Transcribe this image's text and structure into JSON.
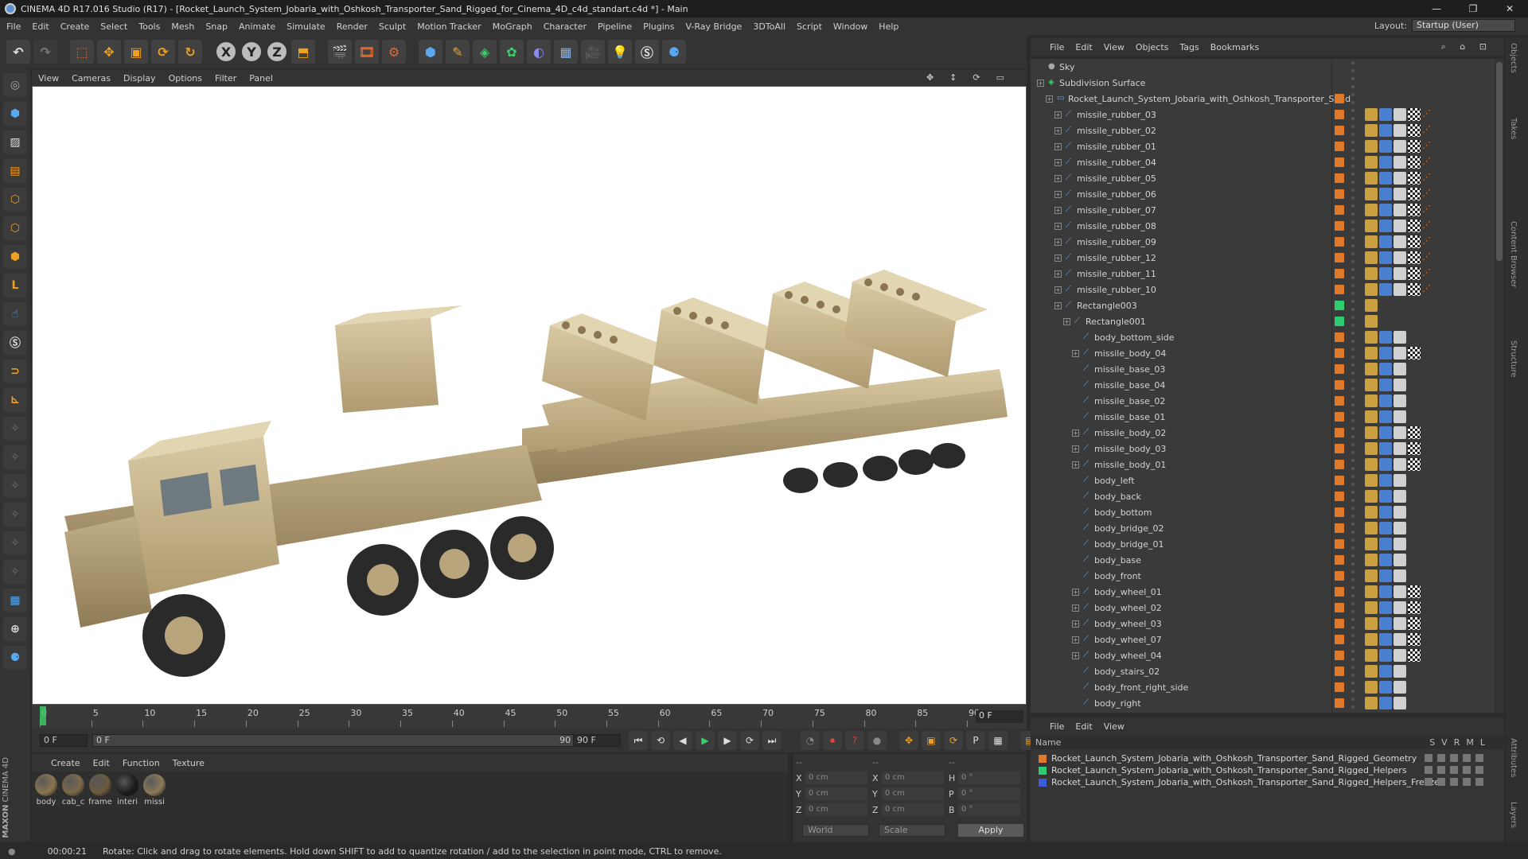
{
  "window": {
    "title": "CINEMA 4D R17.016 Studio (R17) - [Rocket_Launch_System_Jobaria_with_Oshkosh_Transporter_Sand_Rigged_for_Cinema_4D_c4d_standart.c4d *] - Main",
    "controls": [
      "—",
      "❐",
      "✕"
    ]
  },
  "menu": [
    "File",
    "Edit",
    "Create",
    "Select",
    "Tools",
    "Mesh",
    "Snap",
    "Animate",
    "Simulate",
    "Render",
    "Sculpt",
    "Motion Tracker",
    "MoGraph",
    "Character",
    "Pipeline",
    "Plugins",
    "V-Ray Bridge",
    "3DToAll",
    "Script",
    "Window",
    "Help"
  ],
  "layout": {
    "label": "Layout:",
    "value": "Startup (User)"
  },
  "toolbar": {
    "axis_x": "X",
    "axis_y": "Y",
    "axis_z": "Z"
  },
  "viewport_menu": [
    "View",
    "Cameras",
    "Display",
    "Options",
    "Filter",
    "Panel"
  ],
  "timeline": {
    "ticks": [
      "0",
      "5",
      "10",
      "15",
      "20",
      "25",
      "30",
      "35",
      "40",
      "45",
      "50",
      "55",
      "60",
      "65",
      "70",
      "75",
      "80",
      "85",
      "90"
    ],
    "current_frame": "0 F"
  },
  "playback": {
    "start": "0 F",
    "min": "0 F",
    "max_slider": "90 F",
    "end": "90 F"
  },
  "materials_menu": [
    "Create",
    "Edit",
    "Function",
    "Texture"
  ],
  "materials": [
    {
      "label": "body",
      "color": "#8a7650"
    },
    {
      "label": "cab_c",
      "color": "#7d6a48"
    },
    {
      "label": "frame",
      "color": "#6b5a3e"
    },
    {
      "label": "interi",
      "color": "#1c1c1c"
    },
    {
      "label": "missi",
      "color": "#8c7a58"
    }
  ],
  "coords": {
    "header": [
      "--",
      "--",
      "--"
    ],
    "rows": [
      {
        "a": "X",
        "av": "0 cm",
        "b": "X",
        "bv": "0 cm",
        "c": "H",
        "cv": "0 °"
      },
      {
        "a": "Y",
        "av": "0 cm",
        "b": "Y",
        "bv": "0 cm",
        "c": "P",
        "cv": "0 °"
      },
      {
        "a": "Z",
        "av": "0 cm",
        "b": "Z",
        "bv": "0 cm",
        "c": "B",
        "cv": "0 °"
      }
    ],
    "world": "World",
    "scale": "Scale",
    "apply": "Apply"
  },
  "objects_menu": [
    "File",
    "Edit",
    "View",
    "Objects",
    "Tags",
    "Bookmarks"
  ],
  "objects": [
    {
      "name": "Sky",
      "depth": 0,
      "expand": false,
      "icon": "sky",
      "layer": "",
      "tags": 0
    },
    {
      "name": "Subdivision Surface",
      "depth": 0,
      "expand": true,
      "icon": "subdiv",
      "layer": "",
      "tags": 0
    },
    {
      "name": "Rocket_Launch_System_Jobaria_with_Oshkosh_Transporter_Sand",
      "depth": 1,
      "expand": true,
      "icon": "null",
      "layer": "#e07a2a",
      "tags": 0
    },
    {
      "name": "missile_rubber_03",
      "depth": 2,
      "expand": true,
      "icon": "bone",
      "layer": "#e07a2a",
      "tags": 5
    },
    {
      "name": "missile_rubber_02",
      "depth": 2,
      "expand": true,
      "icon": "bone",
      "layer": "#e07a2a",
      "tags": 5
    },
    {
      "name": "missile_rubber_01",
      "depth": 2,
      "expand": true,
      "icon": "bone",
      "layer": "#e07a2a",
      "tags": 5
    },
    {
      "name": "missile_rubber_04",
      "depth": 2,
      "expand": true,
      "icon": "bone",
      "layer": "#e07a2a",
      "tags": 5
    },
    {
      "name": "missile_rubber_05",
      "depth": 2,
      "expand": true,
      "icon": "bone",
      "layer": "#e07a2a",
      "tags": 5
    },
    {
      "name": "missile_rubber_06",
      "depth": 2,
      "expand": true,
      "icon": "bone",
      "layer": "#e07a2a",
      "tags": 5
    },
    {
      "name": "missile_rubber_07",
      "depth": 2,
      "expand": true,
      "icon": "bone",
      "layer": "#e07a2a",
      "tags": 5
    },
    {
      "name": "missile_rubber_08",
      "depth": 2,
      "expand": true,
      "icon": "bone",
      "layer": "#e07a2a",
      "tags": 5
    },
    {
      "name": "missile_rubber_09",
      "depth": 2,
      "expand": true,
      "icon": "bone",
      "layer": "#e07a2a",
      "tags": 5
    },
    {
      "name": "missile_rubber_12",
      "depth": 2,
      "expand": true,
      "icon": "bone",
      "layer": "#e07a2a",
      "tags": 5
    },
    {
      "name": "missile_rubber_11",
      "depth": 2,
      "expand": true,
      "icon": "bone",
      "layer": "#e07a2a",
      "tags": 5
    },
    {
      "name": "missile_rubber_10",
      "depth": 2,
      "expand": true,
      "icon": "bone",
      "layer": "#e07a2a",
      "tags": 5
    },
    {
      "name": "Rectangle003",
      "depth": 2,
      "expand": true,
      "icon": "bone",
      "layer": "#2ecc71",
      "tags": 1
    },
    {
      "name": "Rectangle001",
      "depth": 3,
      "expand": true,
      "icon": "bone",
      "layer": "#2ecc71",
      "tags": 1
    },
    {
      "name": "body_bottom_side",
      "depth": 4,
      "expand": false,
      "icon": "bone",
      "layer": "#e07a2a",
      "tags": 3
    },
    {
      "name": "missile_body_04",
      "depth": 4,
      "expand": true,
      "icon": "bone",
      "layer": "#e07a2a",
      "tags": 4
    },
    {
      "name": "missile_base_03",
      "depth": 4,
      "expand": false,
      "icon": "bone",
      "layer": "#e07a2a",
      "tags": 3
    },
    {
      "name": "missile_base_04",
      "depth": 4,
      "expand": false,
      "icon": "bone",
      "layer": "#e07a2a",
      "tags": 3
    },
    {
      "name": "missile_base_02",
      "depth": 4,
      "expand": false,
      "icon": "bone",
      "layer": "#e07a2a",
      "tags": 3
    },
    {
      "name": "missile_base_01",
      "depth": 4,
      "expand": false,
      "icon": "bone",
      "layer": "#e07a2a",
      "tags": 3
    },
    {
      "name": "missile_body_02",
      "depth": 4,
      "expand": true,
      "icon": "bone",
      "layer": "#e07a2a",
      "tags": 4
    },
    {
      "name": "missile_body_03",
      "depth": 4,
      "expand": true,
      "icon": "bone",
      "layer": "#e07a2a",
      "tags": 4
    },
    {
      "name": "missile_body_01",
      "depth": 4,
      "expand": true,
      "icon": "bone",
      "layer": "#e07a2a",
      "tags": 4
    },
    {
      "name": "body_left",
      "depth": 4,
      "expand": false,
      "icon": "bone",
      "layer": "#e07a2a",
      "tags": 3
    },
    {
      "name": "body_back",
      "depth": 4,
      "expand": false,
      "icon": "bone",
      "layer": "#e07a2a",
      "tags": 3
    },
    {
      "name": "body_bottom",
      "depth": 4,
      "expand": false,
      "icon": "bone",
      "layer": "#e07a2a",
      "tags": 3
    },
    {
      "name": "body_bridge_02",
      "depth": 4,
      "expand": false,
      "icon": "bone",
      "layer": "#e07a2a",
      "tags": 3
    },
    {
      "name": "body_bridge_01",
      "depth": 4,
      "expand": false,
      "icon": "bone",
      "layer": "#e07a2a",
      "tags": 3
    },
    {
      "name": "body_base",
      "depth": 4,
      "expand": false,
      "icon": "bone",
      "layer": "#e07a2a",
      "tags": 3
    },
    {
      "name": "body_front",
      "depth": 4,
      "expand": false,
      "icon": "bone",
      "layer": "#e07a2a",
      "tags": 3
    },
    {
      "name": "body_wheel_01",
      "depth": 4,
      "expand": true,
      "icon": "bone",
      "layer": "#e07a2a",
      "tags": 4
    },
    {
      "name": "body_wheel_02",
      "depth": 4,
      "expand": true,
      "icon": "bone",
      "layer": "#e07a2a",
      "tags": 4
    },
    {
      "name": "body_wheel_03",
      "depth": 4,
      "expand": true,
      "icon": "bone",
      "layer": "#e07a2a",
      "tags": 4
    },
    {
      "name": "body_wheel_07",
      "depth": 4,
      "expand": true,
      "icon": "bone",
      "layer": "#e07a2a",
      "tags": 4
    },
    {
      "name": "body_wheel_04",
      "depth": 4,
      "expand": true,
      "icon": "bone",
      "layer": "#e07a2a",
      "tags": 4
    },
    {
      "name": "body_stairs_02",
      "depth": 4,
      "expand": false,
      "icon": "bone",
      "layer": "#e07a2a",
      "tags": 3
    },
    {
      "name": "body_front_right_side",
      "depth": 4,
      "expand": false,
      "icon": "bone",
      "layer": "#e07a2a",
      "tags": 3
    },
    {
      "name": "body_right",
      "depth": 4,
      "expand": false,
      "icon": "bone",
      "layer": "#e07a2a",
      "tags": 3
    }
  ],
  "layers_menu": [
    "File",
    "Edit",
    "View"
  ],
  "layers_columns": {
    "name": "Name",
    "flags": [
      "S",
      "V",
      "R",
      "M",
      "L"
    ]
  },
  "layers": [
    {
      "name": "Rocket_Launch_System_Jobaria_with_Oshkosh_Transporter_Sand_Rigged_Geometry",
      "color": "#e07a2a"
    },
    {
      "name": "Rocket_Launch_System_Jobaria_with_Oshkosh_Transporter_Sand_Rigged_Helpers",
      "color": "#2ecc71"
    },
    {
      "name": "Rocket_Launch_System_Jobaria_with_Oshkosh_Transporter_Sand_Rigged_Helpers_Freeze",
      "color": "#3b5bdb"
    }
  ],
  "edge_tabs": [
    "Objects",
    "Takes",
    "Content Browser",
    "Structure",
    "Attributes",
    "Layers"
  ],
  "status": {
    "time": "00:00:21",
    "message": "Rotate: Click and drag to rotate elements. Hold down SHIFT to add to quantize rotation / add to the selection in point mode, CTRL to remove."
  },
  "brand": {
    "maxon": "MAXON",
    "c4d": "CINEMA 4D"
  }
}
